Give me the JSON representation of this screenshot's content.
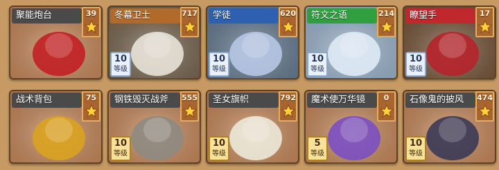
{
  "cards_row1": [
    {
      "name": "聚能炮台",
      "count": "39",
      "title_color": "#4a4a4a",
      "bg": "#c98b5d",
      "art_color": "#c21f24"
    },
    {
      "name": "冬幕卫士",
      "count": "717",
      "title_color": "#b26a2a",
      "bg": "#7c6a55",
      "art_color": "#e8e2d8",
      "level": "10",
      "level_label": "等级",
      "level_style": "blue"
    },
    {
      "name": "学徒",
      "count": "620",
      "title_color": "#2e5fb0",
      "bg": "#6a7f95",
      "art_color": "#b7c7e4",
      "level": "10",
      "level_label": "等级",
      "level_style": "blue"
    },
    {
      "name": "符文之语",
      "count": "214",
      "title_color": "#2f9f3f",
      "bg": "#9fb7cf",
      "art_color": "#dfeaf5",
      "level": "10",
      "level_label": "等级",
      "level_style": "blue"
    },
    {
      "name": "瞭望手",
      "count": "17",
      "title_color": "#c0282e",
      "bg": "#7a5a3f",
      "art_color": "#b5242b",
      "level": "10",
      "level_label": "等级",
      "level_style": "blue"
    }
  ],
  "cards_row2": [
    {
      "name": "战术背包",
      "count": "75",
      "title_color": "#4a4a4a",
      "bg": "#c98b5d",
      "art_color": "#d9a21f"
    },
    {
      "name": "钢铁毁灭战斧",
      "count": "555",
      "title_color": "#4a4a4a",
      "bg": "#c98b5d",
      "art_color": "#8e8a82",
      "level": "10",
      "level_label": "等级",
      "level_style": "gold"
    },
    {
      "name": "圣女旗帜",
      "count": "792",
      "title_color": "#4a4a4a",
      "bg": "#c98b5d",
      "art_color": "#ece8d8",
      "level": "10",
      "level_label": "等级",
      "level_style": "gold"
    },
    {
      "name": "魔术使万华镜",
      "count": "0",
      "title_color": "#4a4a4a",
      "bg": "#c98b5d",
      "art_color": "#7b4fc2",
      "level": "5",
      "level_label": "等级",
      "level_style": "gold"
    },
    {
      "name": "石像鬼的披风",
      "count": "474",
      "title_color": "#4a4a4a",
      "bg": "#c98b5d",
      "art_color": "#3b3a55",
      "level": "10",
      "level_label": "等级",
      "level_style": "gold"
    }
  ],
  "icons": {
    "count_badge_icon": "star-icon"
  }
}
